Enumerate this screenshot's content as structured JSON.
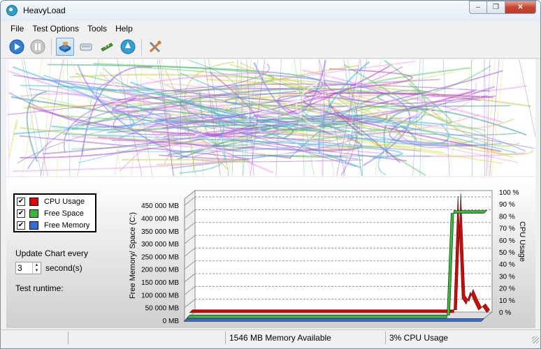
{
  "window": {
    "title": "HeavyLoad",
    "minimize": "–",
    "maximize": "❐",
    "close": "✕"
  },
  "menu": {
    "items": [
      "File",
      "Test Options",
      "Tools",
      "Help"
    ]
  },
  "toolbar": {
    "buttons": [
      {
        "icon": "play-icon"
      },
      {
        "icon": "pause-icon"
      },
      {
        "icon": "cpu-load-icon"
      },
      {
        "icon": "disk-load-icon"
      },
      {
        "icon": "memory-load-icon"
      },
      {
        "icon": "gpu-load-icon"
      },
      {
        "icon": "tools-icon"
      }
    ]
  },
  "legend": {
    "items": [
      {
        "label": "CPU Usage",
        "color": "#e00000",
        "checked": "✔"
      },
      {
        "label": "Free Space",
        "color": "#33bb33",
        "checked": "✔"
      },
      {
        "label": "Free Memory",
        "color": "#2f6fd6",
        "checked": "✔"
      }
    ]
  },
  "controls": {
    "update_label": "Update Chart every",
    "update_value": "3",
    "seconds_label": "second(s)",
    "runtime_label": "Test runtime:"
  },
  "chart_data": {
    "type": "area",
    "ylabel": "Free Memory/ Space (C:)",
    "y2label": "CPU Usage",
    "left_ticks": [
      "0 MB",
      "50 000 MB",
      "100 000 MB",
      "150 000 MB",
      "200 000 MB",
      "250 000 MB",
      "300 000 MB",
      "350 000 MB",
      "400 000 MB",
      "450 000 MB"
    ],
    "right_ticks": [
      "0 %",
      "10 %",
      "20 %",
      "30 %",
      "40 %",
      "50 %",
      "60 %",
      "70 %",
      "80 %",
      "90 %",
      "100 %"
    ],
    "ylim": [
      0,
      475000
    ],
    "y2lim": [
      0,
      100
    ],
    "series": [
      {
        "name": "CPU Usage",
        "color": "#e00000",
        "axis": "right",
        "values": [
          3,
          3,
          3,
          3,
          3,
          3,
          3,
          3,
          3,
          3,
          3,
          3,
          3,
          3,
          3,
          3,
          3,
          3,
          3,
          3,
          3,
          3,
          3,
          3,
          3,
          3,
          3,
          3,
          3,
          3,
          3,
          3,
          3,
          3,
          3,
          3,
          3,
          3,
          3,
          3,
          3,
          3,
          3,
          3,
          3,
          3,
          3,
          3,
          3,
          3,
          3,
          3,
          3,
          3,
          3,
          3,
          3,
          3,
          3,
          3,
          3,
          3,
          3,
          3,
          3,
          100,
          15,
          10,
          20,
          12,
          5,
          8,
          3
        ]
      },
      {
        "name": "Free Space",
        "color": "#33bb33",
        "axis": "right",
        "values": [
          1,
          1,
          1,
          1,
          1,
          1,
          1,
          1,
          1,
          1,
          1,
          1,
          1,
          1,
          1,
          1,
          1,
          1,
          1,
          1,
          1,
          1,
          1,
          1,
          1,
          1,
          1,
          1,
          1,
          1,
          1,
          1,
          1,
          1,
          1,
          1,
          1,
          1,
          1,
          1,
          1,
          1,
          1,
          1,
          1,
          1,
          1,
          1,
          1,
          1,
          1,
          1,
          1,
          1,
          1,
          1,
          1,
          1,
          1,
          1,
          1,
          1,
          1,
          1,
          88,
          88,
          88,
          88,
          88,
          88,
          88,
          88,
          88
        ]
      },
      {
        "name": "Free Memory",
        "color": "#2f6fd6",
        "axis": "left",
        "values": [
          1546,
          1546,
          1546,
          1546,
          1546,
          1546,
          1546,
          1546,
          1546,
          1546,
          1546,
          1546,
          1546,
          1546,
          1546,
          1546,
          1546,
          1546,
          1546,
          1546,
          1546,
          1546,
          1546,
          1546,
          1546,
          1546,
          1546,
          1546,
          1546,
          1546,
          1546,
          1546,
          1546,
          1546,
          1546,
          1546,
          1546,
          1546,
          1546,
          1546,
          1546,
          1546,
          1546,
          1546,
          1546,
          1546,
          1546,
          1546,
          1546,
          1546,
          1546,
          1546,
          1546,
          1546,
          1546,
          1546,
          1546,
          1546,
          1546,
          1546,
          1546,
          1546,
          1546,
          1546,
          1546,
          1546,
          1546,
          1546,
          1546,
          1546,
          1546,
          1546,
          1546
        ]
      }
    ],
    "grid": true,
    "legend": "left"
  },
  "status": {
    "cell1": "",
    "memory": "1546 MB Memory Available",
    "cpu": "3% CPU Usage"
  }
}
